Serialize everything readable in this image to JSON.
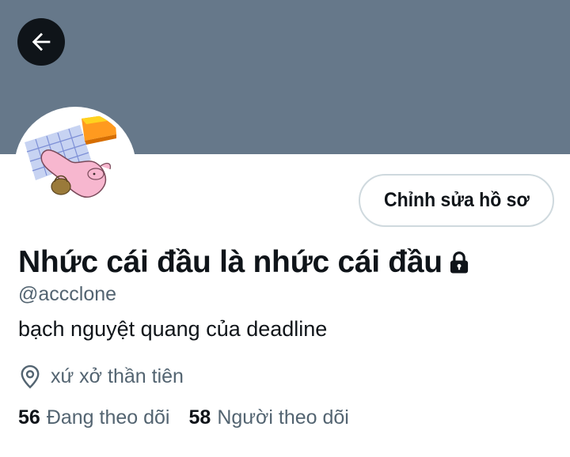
{
  "header": {
    "back_icon": "arrow-left-icon",
    "banner_color": "#66788a",
    "back_button_color": "#0f1419"
  },
  "profile": {
    "avatar_icon": "avatar-image",
    "edit_button_label": "Chỉnh sửa hồ sơ",
    "display_name": "Nhức cái đầu là nhức cái đầu",
    "protected_icon": "lock-icon",
    "handle": "@accclone",
    "bio": "bạch nguyệt quang của deadline",
    "location_icon": "map-pin-icon",
    "location": "xứ xở thần tiên"
  },
  "stats": {
    "following_count": "56",
    "following_label": "Đang theo dõi",
    "followers_count": "58",
    "followers_label": "Người theo dõi"
  },
  "colors": {
    "primary_text": "#0f1419",
    "secondary_text": "#536471",
    "border": "#cfd9de"
  }
}
